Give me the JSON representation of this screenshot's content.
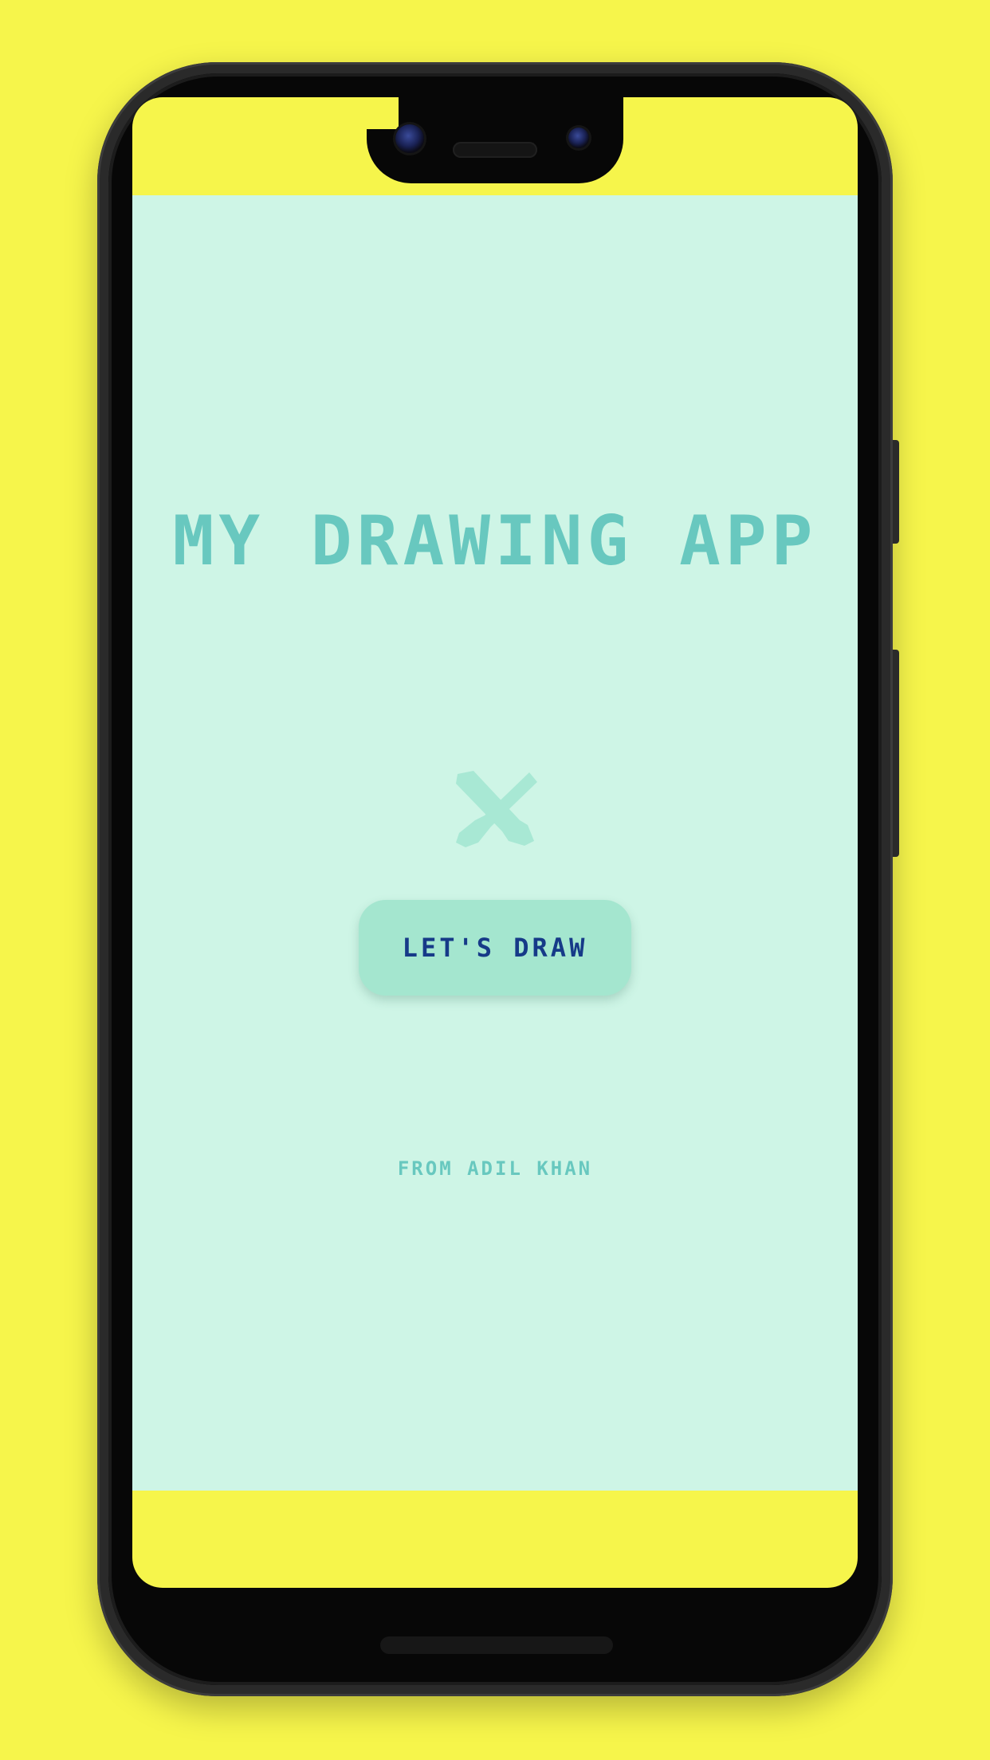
{
  "colors": {
    "background": "#f6f54b",
    "app_background": "#cef5e6",
    "accent": "#68c8bf",
    "button_fill": "#a4e6cf",
    "button_text": "#163a88"
  },
  "app": {
    "title": "MY DRAWING APP",
    "logo_icon": "paintbrush-cross-icon",
    "cta_label": "LET'S DRAW",
    "author": "FROM ADIL KHAN"
  }
}
